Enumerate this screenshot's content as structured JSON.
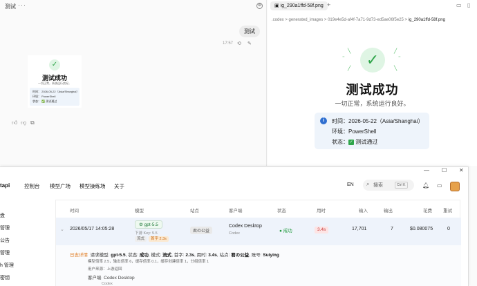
{
  "chat": {
    "title": "测试",
    "more": "···",
    "user_message": "测试",
    "time": "17:57",
    "thumbnail": {
      "title": "测试成功",
      "subtitle": "一切正常，系统运行良好。",
      "lines": [
        "时间：  2026-05-22（Asia/Shanghai）",
        "环境：  PowerShell",
        "状态：  ✅ 测试通过"
      ]
    }
  },
  "viewer": {
    "tab_label": "ig_290a1ffd-58f.png",
    "crumbs": [
      ".codex",
      "generated_images",
      "019e4e5d-af4f-7a71-9d73-ed5ae06f5e25"
    ],
    "crumb_current": "ig_290a1ffd-58f.png",
    "title": "测试成功",
    "subtitle": "一切正常，系统运行良好。",
    "info": {
      "time_label": "时间：",
      "time_value": "2026-05-22（Asia/Shanghai）",
      "env_label": "环境：",
      "env_value": "PowerShell",
      "status_label": "状态：",
      "status_value": "测试通过"
    }
  },
  "app": {
    "brand": "tapi",
    "nav": [
      "控制台",
      "模型广场",
      "模型操练场",
      "关于"
    ],
    "lang": "EN",
    "search_placeholder": "搜索",
    "search_kbd": "Ctrl K",
    "sidebar": [
      "盘",
      "管理",
      "公告",
      "管理",
      "h 管理",
      "密钥"
    ],
    "columns": [
      "时间",
      "模型",
      "站点",
      "客户端",
      "状态",
      "用时",
      "输入",
      "输出",
      "花费",
      "重试"
    ],
    "row": {
      "time": "2026/05/17 14:05:28",
      "model": "gpt-5.5",
      "model_sub": "下游 Key: 5.5",
      "mode_pill": "流式",
      "first_pill": "首字 2.3s",
      "site": "君の公益",
      "client": "Codex Desktop",
      "client_sub": "Codex",
      "status": "● 成功",
      "duration": "3.4s",
      "input": "17,701",
      "output": "7",
      "cost": "$0.080075",
      "retry": "0"
    },
    "detail": {
      "label": "日志详情",
      "model_label": "请求模型:",
      "model": "gpt-5.5",
      "status_label": "状态:",
      "status": "成功",
      "mode_label": "模式:",
      "mode": "流式",
      "first_label": "首字:",
      "first": "2.3s",
      "total_label": "用时:",
      "total": "3.4s",
      "site_label": "站点:",
      "site": "君の公益",
      "account_label": "账号:",
      "account": "Suiying",
      "line2": "模型倍率 2.5，输出倍率 6，缓存倍率 0.1，缓存创建倍率 1，分组倍率 1",
      "line3": "用户来源：上游返回",
      "client_label": "客户端",
      "client": "Codex Desktop",
      "client_sub": "Codex"
    }
  }
}
